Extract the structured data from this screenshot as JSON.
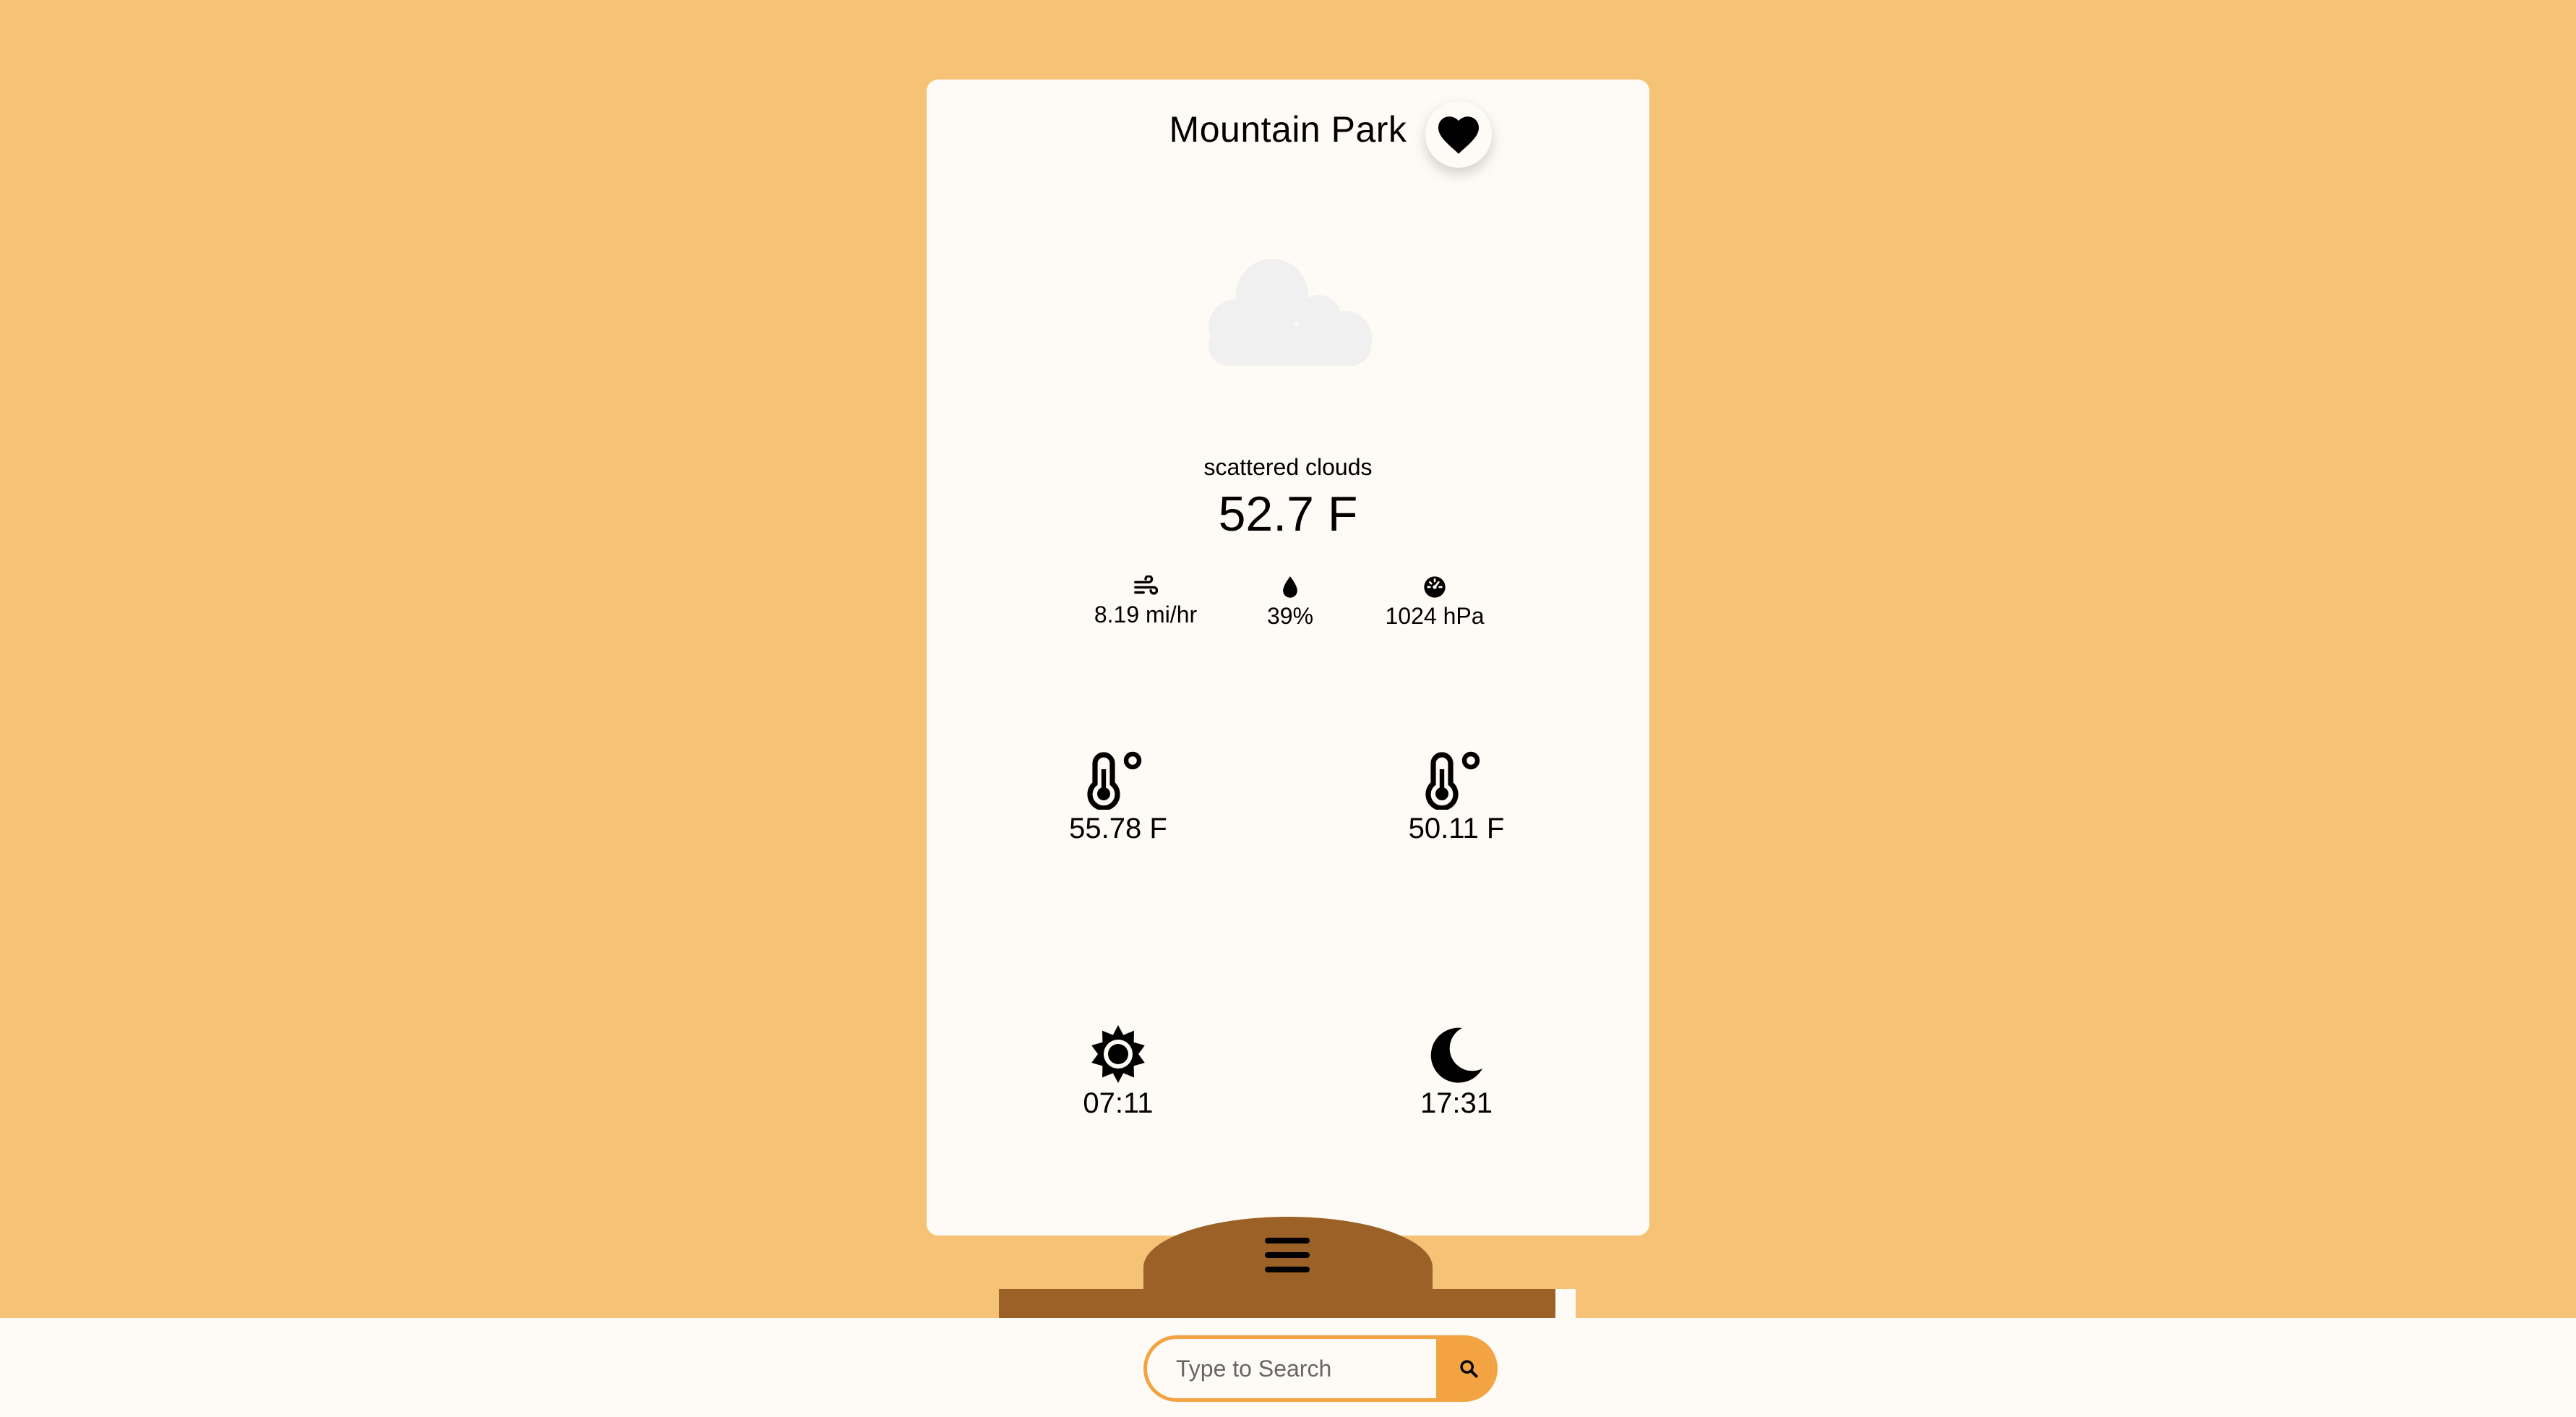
{
  "location": {
    "name": "Mountain Park",
    "favorite_icon": "heart-icon"
  },
  "weather": {
    "icon": "cloud-icon",
    "description": "scattered clouds",
    "temperature": "52.7 F"
  },
  "stats": {
    "wind": {
      "icon": "wind-icon",
      "value": "8.19 mi/hr"
    },
    "humidity": {
      "icon": "droplet-icon",
      "value": "39%"
    },
    "pressure": {
      "icon": "gauge-icon",
      "value": "1024 hPa"
    }
  },
  "details": {
    "temp_max": {
      "icon": "thermometer-icon",
      "value": "55.78 F"
    },
    "temp_min": {
      "icon": "thermometer-icon",
      "value": "50.11 F"
    },
    "sunrise": {
      "icon": "sun-icon",
      "value": "07:11"
    },
    "sunset": {
      "icon": "moon-icon",
      "value": "17:31"
    }
  },
  "menu": {
    "icon": "hamburger-menu-icon"
  },
  "search": {
    "placeholder": "Type to Search",
    "button_icon": "search-icon"
  },
  "colors": {
    "background": "#F5C276",
    "card": "#FEFBF6",
    "accent": "#F4A343",
    "drawer": "#9C6126"
  }
}
